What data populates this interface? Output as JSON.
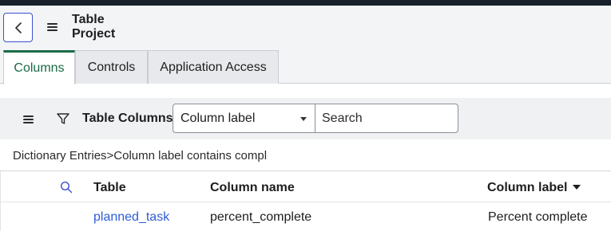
{
  "header": {
    "title_line1": "Table",
    "title_line2": "Project",
    "back_icon": "chevron-left-icon",
    "menu_icon": "hamburger-icon"
  },
  "tabs": [
    {
      "label": "Columns",
      "active": true
    },
    {
      "label": "Controls",
      "active": false
    },
    {
      "label": "Application Access",
      "active": false
    }
  ],
  "list_toolbar": {
    "title": "Table Columns",
    "field_select": {
      "selected": "Column label"
    },
    "search": {
      "placeholder": "Search",
      "value": ""
    }
  },
  "breadcrumb": "Dictionary Entries>Column label contains compl",
  "grid": {
    "columns": [
      "Table",
      "Column name",
      "Column label"
    ],
    "sorted_column": "Column label",
    "rows": [
      {
        "table": "planned_task",
        "column_name": "percent_complete",
        "column_label": "Percent complete"
      }
    ]
  },
  "colors": {
    "accent": "#1a6b47",
    "link": "#2e5bd8",
    "back_button_border": "#3b50ce",
    "topbar": "#17202b"
  }
}
